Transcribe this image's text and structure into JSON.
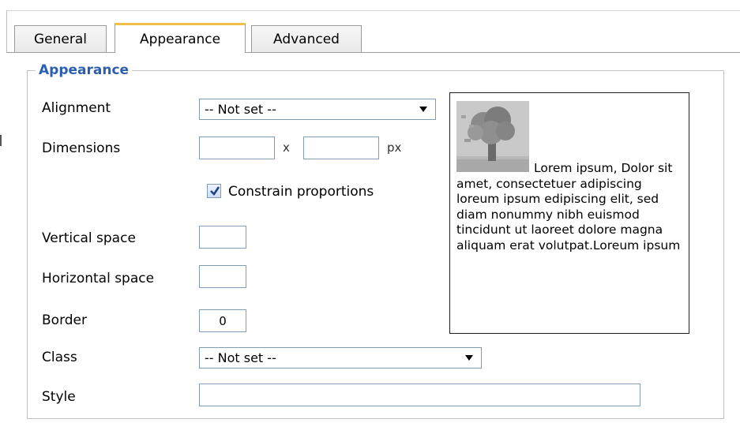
{
  "tabs": [
    {
      "label": "General",
      "active": false
    },
    {
      "label": "Appearance",
      "active": true
    },
    {
      "label": "Advanced",
      "active": false
    }
  ],
  "fieldset": {
    "legend": "Appearance"
  },
  "form": {
    "alignment": {
      "label": "Alignment",
      "value": "-- Not set --"
    },
    "dimensions": {
      "label": "Dimensions",
      "width": "",
      "height": "",
      "separator": "x",
      "unit": "px"
    },
    "constrain": {
      "label": "Constrain proportions",
      "checked": true
    },
    "vspace": {
      "label": "Vertical space",
      "value": ""
    },
    "hspace": {
      "label": "Horizontal space",
      "value": ""
    },
    "border": {
      "label": "Border",
      "value": "0"
    },
    "class": {
      "label": "Class",
      "value": "-- Not set --"
    },
    "style": {
      "label": "Style",
      "value": ""
    }
  },
  "preview": {
    "text": "Lorem ipsum, Dolor sit amet, consectetuer adipiscing loreum ipsum edipiscing elit, sed diam nonummy nibh euismod tincidunt ut laoreet dolore magna aliquam erat volutpat.Loreum ipsum"
  },
  "colors": {
    "legend": "#2a5fb0",
    "active_tab_accent": "#f2c04a",
    "input_border": "#7f9db9"
  }
}
